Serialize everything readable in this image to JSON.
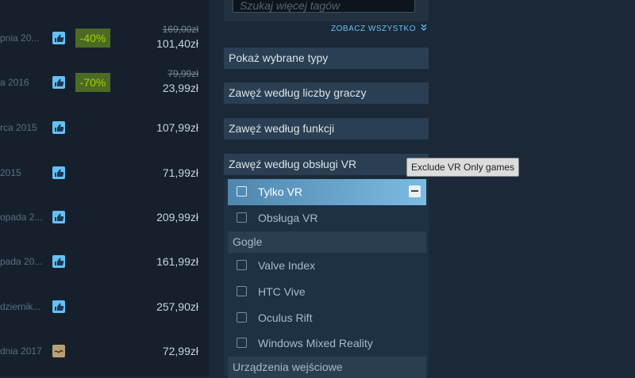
{
  "colors": {
    "accent": "#66c0f4",
    "discount_bg": "#4c6b22",
    "discount_text": "#a4d007",
    "page_bg": "#1b2838"
  },
  "results": [
    {
      "date": "pnia 20...",
      "review": "positive-icon",
      "discount": "-40%",
      "original_price": "169,00zł",
      "final_price": "101,40zł"
    },
    {
      "date": "a 2016",
      "review": "positive-icon",
      "discount": "-70%",
      "original_price": "79,99zł",
      "final_price": "23,99zł"
    },
    {
      "date": "rca 2015",
      "review": "positive-icon",
      "final_price": "107,99zł"
    },
    {
      "date": "2015",
      "review": "positive-icon",
      "final_price": "71,99zł"
    },
    {
      "date": "opada 2...",
      "review": "positive-icon",
      "final_price": "209,99zł"
    },
    {
      "date": "pada 20...",
      "review": "positive-icon",
      "final_price": "161,99zł"
    },
    {
      "date": "dziernik...",
      "review": "positive-icon",
      "final_price": "257,90zł"
    },
    {
      "date": "dnia 2017",
      "review": "mixed-icon",
      "final_price": "72,99zł"
    }
  ],
  "tag_search": {
    "placeholder": "Szukaj więcej tagów"
  },
  "see_all": "ZOBACZ WSZYSTKO",
  "sections": {
    "types": "Pokaż wybrane typy",
    "players": "Zawęź według liczby graczy",
    "features": "Zawęź według funkcji",
    "vr": "Zawęź według obsługi VR"
  },
  "vr_options": [
    "Tylko VR",
    "Obsługa VR"
  ],
  "groups": {
    "headsets": "Gogle",
    "input": "Urządzenia wejściowe"
  },
  "headsets": [
    "Valve Index",
    "HTC Vive",
    "Oculus Rift",
    "Windows Mixed Reality"
  ],
  "tooltip": "Exclude VR Only games"
}
